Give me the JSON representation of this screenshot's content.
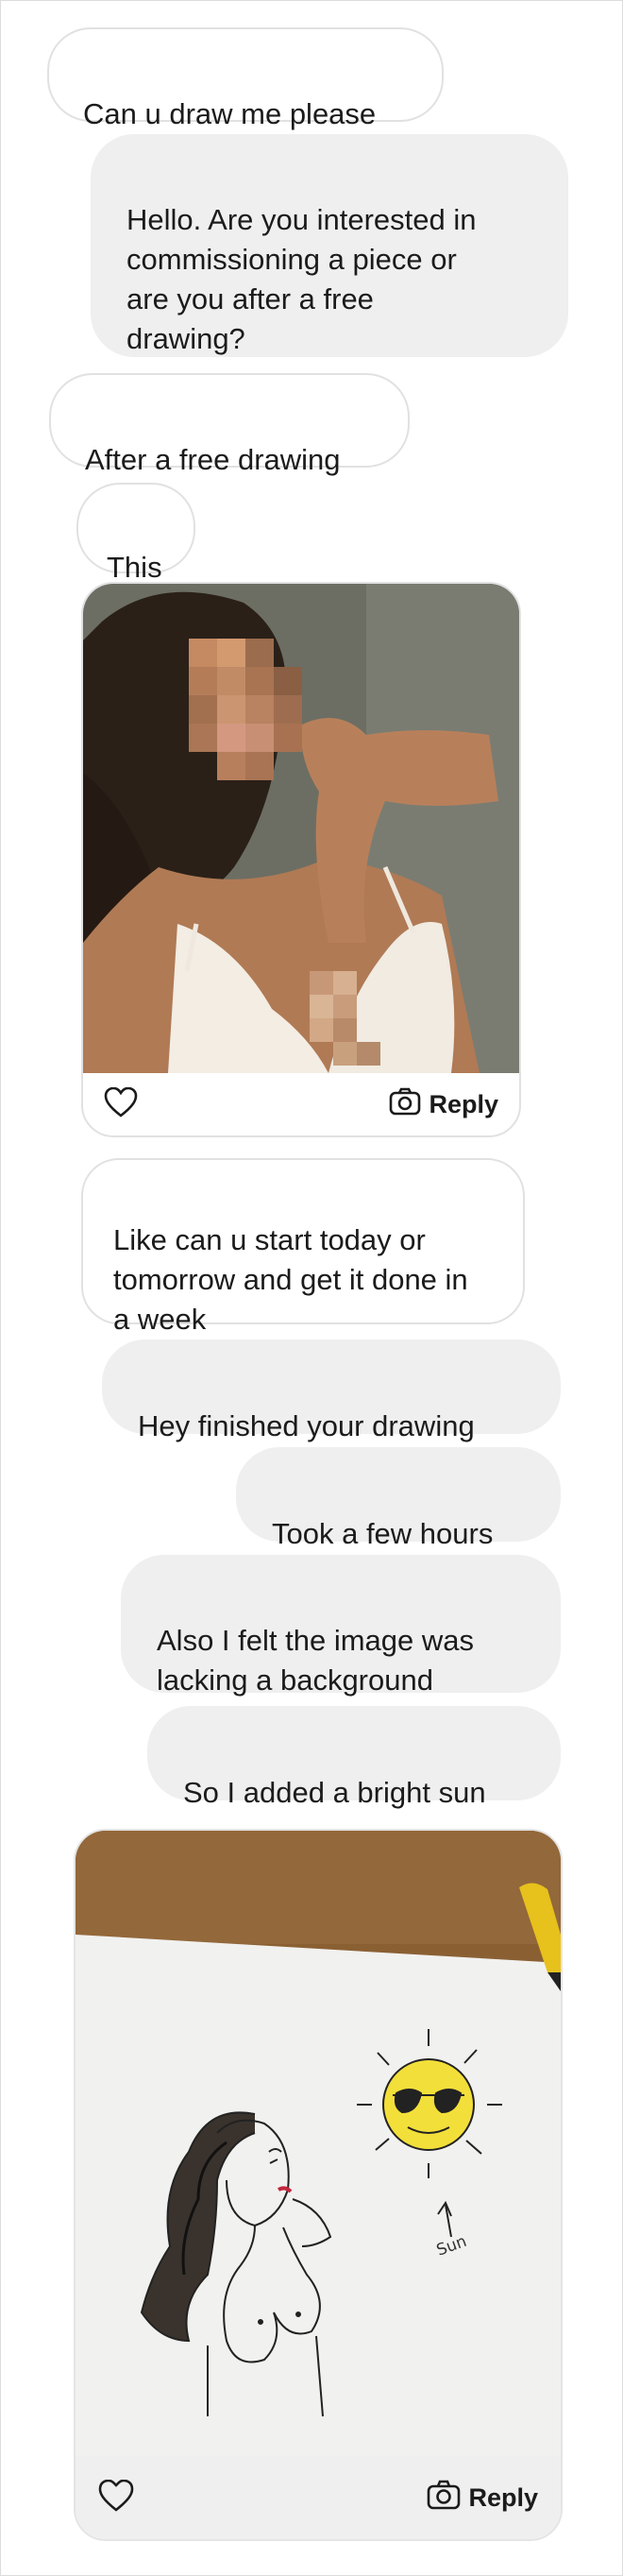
{
  "messages": [
    {
      "text": "Can u draw me please"
    },
    {
      "text": "Hello. Are you interested in\ncommissioning a piece or\nare you after a free\ndrawing?"
    },
    {
      "text": "After a free drawing"
    },
    {
      "text": "This"
    },
    {
      "text": "Like can u start today or\ntomorrow and get it done in\na week"
    },
    {
      "text": "Hey finished your drawing"
    },
    {
      "text": "Took a few hours"
    },
    {
      "text": "Also I felt the image was\nlacking a background"
    },
    {
      "text": "So I added a bright sun"
    }
  ],
  "media": {
    "photo": {
      "reply_label": "Reply",
      "like_icon": "heart-icon",
      "camera_icon": "camera-icon"
    },
    "drawing": {
      "reply_label": "Reply",
      "annotation": "Sun",
      "like_icon": "heart-icon",
      "camera_icon": "camera-icon"
    }
  },
  "colors": {
    "outgoing_bubble": "#efefef",
    "incoming_border": "#e1e1e1",
    "text": "#1b1b1b"
  }
}
